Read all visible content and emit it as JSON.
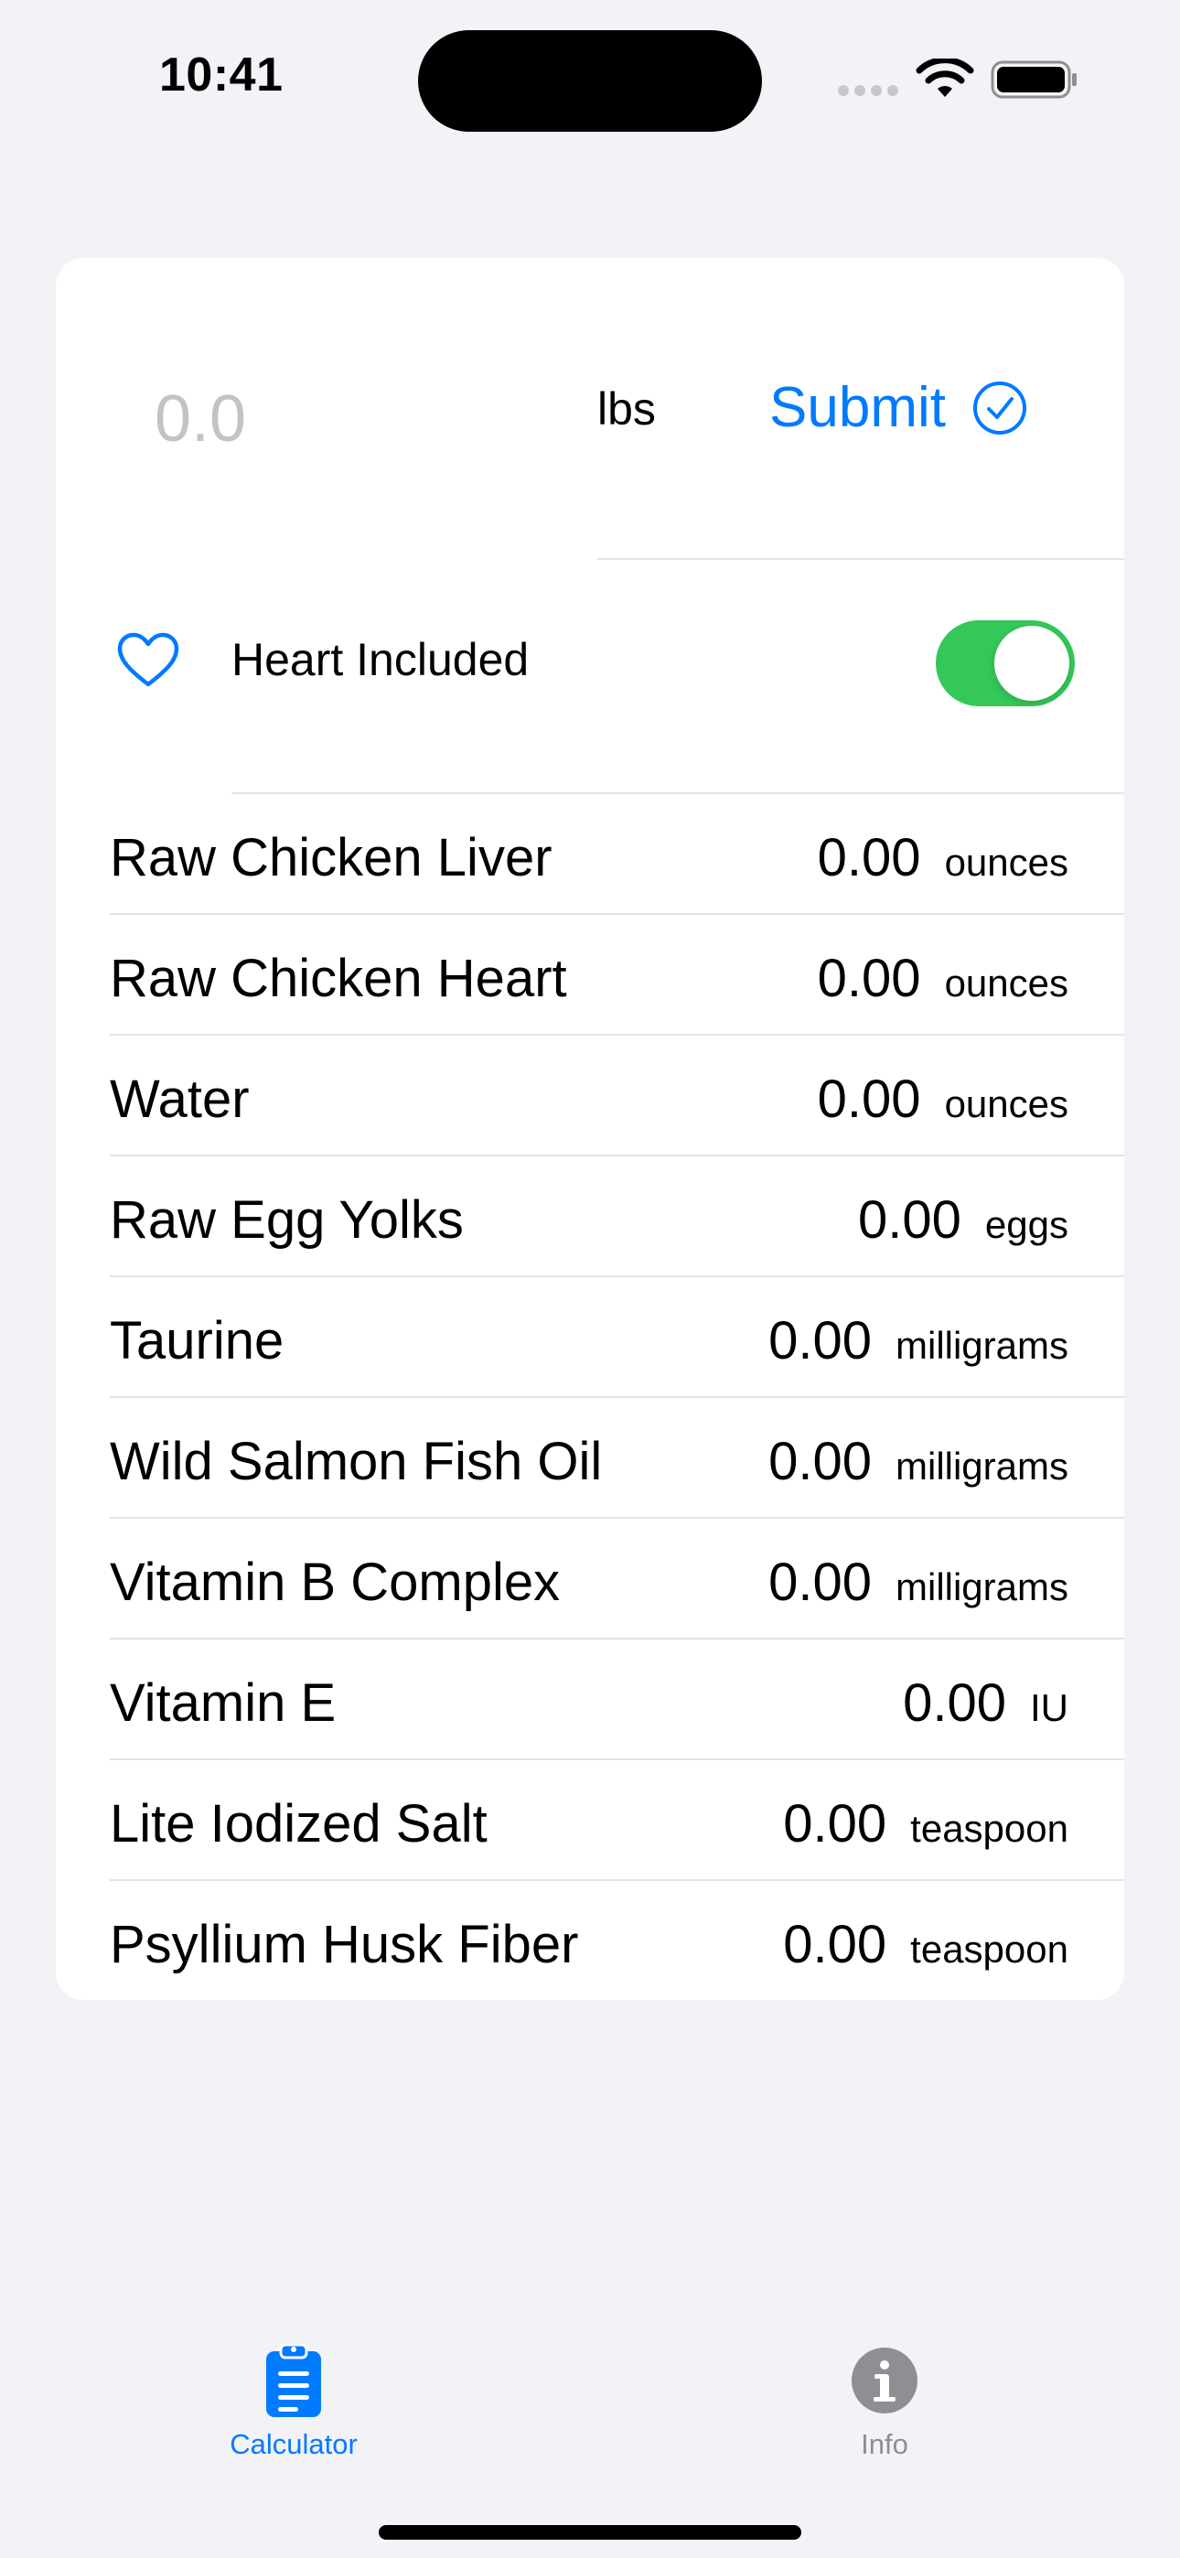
{
  "status_bar": {
    "time": "10:41"
  },
  "weight": {
    "placeholder": "0.0",
    "value": "",
    "unit": "lbs"
  },
  "submit": {
    "label": "Submit",
    "icon": "checkmark-circle-icon"
  },
  "heart_included": {
    "label": "Heart Included",
    "icon": "heart-icon",
    "enabled": true
  },
  "ingredients": [
    {
      "name": "Raw Chicken Liver",
      "value": "0.00",
      "unit": "ounces"
    },
    {
      "name": "Raw Chicken Heart",
      "value": "0.00",
      "unit": "ounces"
    },
    {
      "name": "Water",
      "value": "0.00",
      "unit": "ounces"
    },
    {
      "name": "Raw Egg Yolks",
      "value": "0.00",
      "unit": "eggs"
    },
    {
      "name": "Taurine",
      "value": "0.00",
      "unit": "milligrams"
    },
    {
      "name": "Wild Salmon Fish Oil",
      "value": "0.00",
      "unit": "milligrams"
    },
    {
      "name": "Vitamin B Complex",
      "value": "0.00",
      "unit": "milligrams"
    },
    {
      "name": "Vitamin E",
      "value": "0.00",
      "unit": "IU"
    },
    {
      "name": "Lite Iodized Salt",
      "value": "0.00",
      "unit": "teaspoon"
    },
    {
      "name": "Psyllium Husk Fiber",
      "value": "0.00",
      "unit": "teaspoon"
    }
  ],
  "tabs": [
    {
      "label": "Calculator",
      "icon": "clipboard-icon",
      "selected": true
    },
    {
      "label": "Info",
      "icon": "info-circle-icon",
      "selected": false
    }
  ],
  "colors": {
    "accent": "#007aff",
    "toggle_on": "#34c759",
    "background": "#f2f2f7",
    "inactive": "#8e8e93"
  }
}
